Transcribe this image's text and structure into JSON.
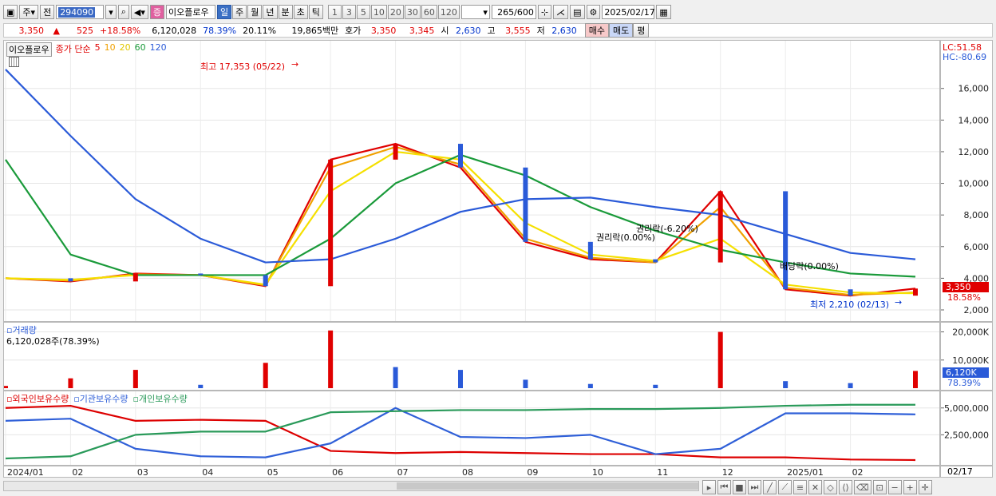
{
  "toolbar": {
    "type_label": "주",
    "prev_label": "전",
    "code_value": "294090",
    "stock_badge": "증",
    "stock_name": "이오플로우",
    "periods": [
      "일",
      "주",
      "월",
      "년",
      "분",
      "초",
      "틱"
    ],
    "period_active": "일",
    "nums": [
      "1",
      "3",
      "5",
      "10",
      "20",
      "30",
      "60",
      "120"
    ],
    "count_value": "265",
    "count_total": "/600",
    "date_value": "2025/02/17"
  },
  "quote": {
    "price": "3,350",
    "arrow": "▲",
    "change": "525",
    "change_pct": "+18.58%",
    "volume": "6,120,028",
    "vol_ratio": "78.39%",
    "turnover": "20.11%",
    "amount": "19,865백만",
    "bid_label": "호가",
    "ask": "3,350",
    "bid": "3,345",
    "open_label": "시",
    "open": "2,630",
    "high_label": "고",
    "high": "3,555",
    "low_label": "저",
    "low": "2,630",
    "buy_label": "매수",
    "sell_label": "매도",
    "eval_label": "평"
  },
  "price_panel": {
    "title": "이오플로우",
    "legend_prefix": "종가 단순",
    "ma_labels": [
      "5",
      "10",
      "20",
      "60",
      "120"
    ],
    "ma_colors": [
      "#e00000",
      "#f0a000",
      "#f5e000",
      "#1a9a3a",
      "#2a5ad8"
    ],
    "lc": "LC:51.58",
    "hc": "HC:-80.69",
    "high_note": "최고 17,353 (05/22)",
    "low_note": "최저 2,210 (02/13)",
    "ann1": "권리락(0.00%)",
    "ann2": "권리락(-6.20%)",
    "ann3": "배당락(0.00%)",
    "last_price_tag": "3,350",
    "last_pct_tag": "18.58%"
  },
  "volume_panel": {
    "title": "거래량",
    "value": "6,120,028주(78.39%)",
    "last_tag": "6,120K",
    "last_pct": "78.39%"
  },
  "holding_panel": {
    "legend": [
      "외국인보유수량",
      "기관보유수량",
      "개인보유수량"
    ],
    "colors": [
      "#dd0000",
      "#3060d8",
      "#2a9a5a"
    ]
  },
  "xaxis_labels": [
    "2024/01",
    "02",
    "03",
    "04",
    "05",
    "06",
    "07",
    "08",
    "09",
    "10",
    "11",
    "12",
    "2025/01",
    "02"
  ],
  "xaxis_end": "02/17",
  "chart_data": [
    {
      "type": "line",
      "title": "이오플로우",
      "ylim": [
        2000,
        17500
      ],
      "yticks": [
        2000,
        4000,
        6000,
        8000,
        10000,
        12000,
        14000,
        16000
      ],
      "ytick_labels": [
        "2,000",
        "4,000",
        "6,000",
        "8,000",
        "10,000",
        "12,000",
        "14,000",
        "16,000"
      ],
      "x": [
        "2024/01",
        "02",
        "03",
        "04",
        "05",
        "06",
        "07",
        "08",
        "09",
        "10",
        "11",
        "12",
        "2025/01",
        "02",
        "02/17"
      ],
      "series": [
        {
          "name": "5",
          "values": [
            4000,
            3800,
            4300,
            4200,
            3500,
            11500,
            12500,
            11000,
            6300,
            5200,
            5000,
            9500,
            3300,
            2900,
            3350
          ]
        },
        {
          "name": "10",
          "values": [
            4000,
            3850,
            4250,
            4200,
            3550,
            11000,
            12300,
            11200,
            6500,
            5300,
            5000,
            8500,
            3400,
            2950,
            3100
          ]
        },
        {
          "name": "20",
          "values": [
            4000,
            3900,
            4200,
            4200,
            3600,
            9500,
            12000,
            11500,
            7500,
            5500,
            5100,
            6500,
            3600,
            3100,
            3050
          ]
        },
        {
          "name": "60",
          "values": [
            11500,
            5500,
            4200,
            4200,
            4200,
            6500,
            10000,
            11800,
            10500,
            8500,
            7000,
            5800,
            5000,
            4300,
            4100
          ]
        },
        {
          "name": "120",
          "values": [
            17200,
            13000,
            9000,
            6500,
            5000,
            5200,
            6500,
            8200,
            9000,
            9100,
            8500,
            8000,
            6800,
            5600,
            5200
          ]
        }
      ]
    },
    {
      "type": "bar",
      "title": "거래량",
      "ylim": [
        0,
        21000
      ],
      "yticks": [
        10000,
        20000
      ],
      "ytick_labels": [
        "10,000K",
        "20,000K"
      ],
      "categories": [
        "2024/01",
        "02",
        "03",
        "04",
        "05",
        "06",
        "07",
        "08",
        "09",
        "10",
        "11",
        "12",
        "2025/01",
        "02",
        "02/17"
      ],
      "values": [
        800,
        3500,
        6500,
        1200,
        9000,
        20500,
        7500,
        6500,
        3000,
        1500,
        1200,
        20000,
        2500,
        1800,
        6120
      ]
    },
    {
      "type": "line",
      "title": "보유수량",
      "ylim": [
        0,
        5800000
      ],
      "yticks": [
        2500000,
        5000000
      ],
      "ytick_labels": [
        "2,500,000",
        "5,000,000"
      ],
      "x": [
        "2024/01",
        "02",
        "03",
        "04",
        "05",
        "06",
        "07",
        "08",
        "09",
        "10",
        "11",
        "12",
        "2025/01",
        "02",
        "02/17"
      ],
      "series": [
        {
          "name": "외국인보유수량",
          "values": [
            5000000,
            5200000,
            3800000,
            3900000,
            3800000,
            1000000,
            800000,
            900000,
            800000,
            700000,
            700000,
            400000,
            400000,
            200000,
            150000
          ]
        },
        {
          "name": "기관보유수량",
          "values": [
            3800000,
            4000000,
            1200000,
            500000,
            400000,
            1700000,
            5000000,
            2300000,
            2200000,
            2500000,
            700000,
            1200000,
            4500000,
            4500000,
            4400000
          ]
        },
        {
          "name": "개인보유수량",
          "values": [
            300000,
            500000,
            2500000,
            2800000,
            2800000,
            4600000,
            4700000,
            4800000,
            4800000,
            4900000,
            4900000,
            5000000,
            5200000,
            5300000,
            5300000
          ]
        }
      ]
    }
  ]
}
